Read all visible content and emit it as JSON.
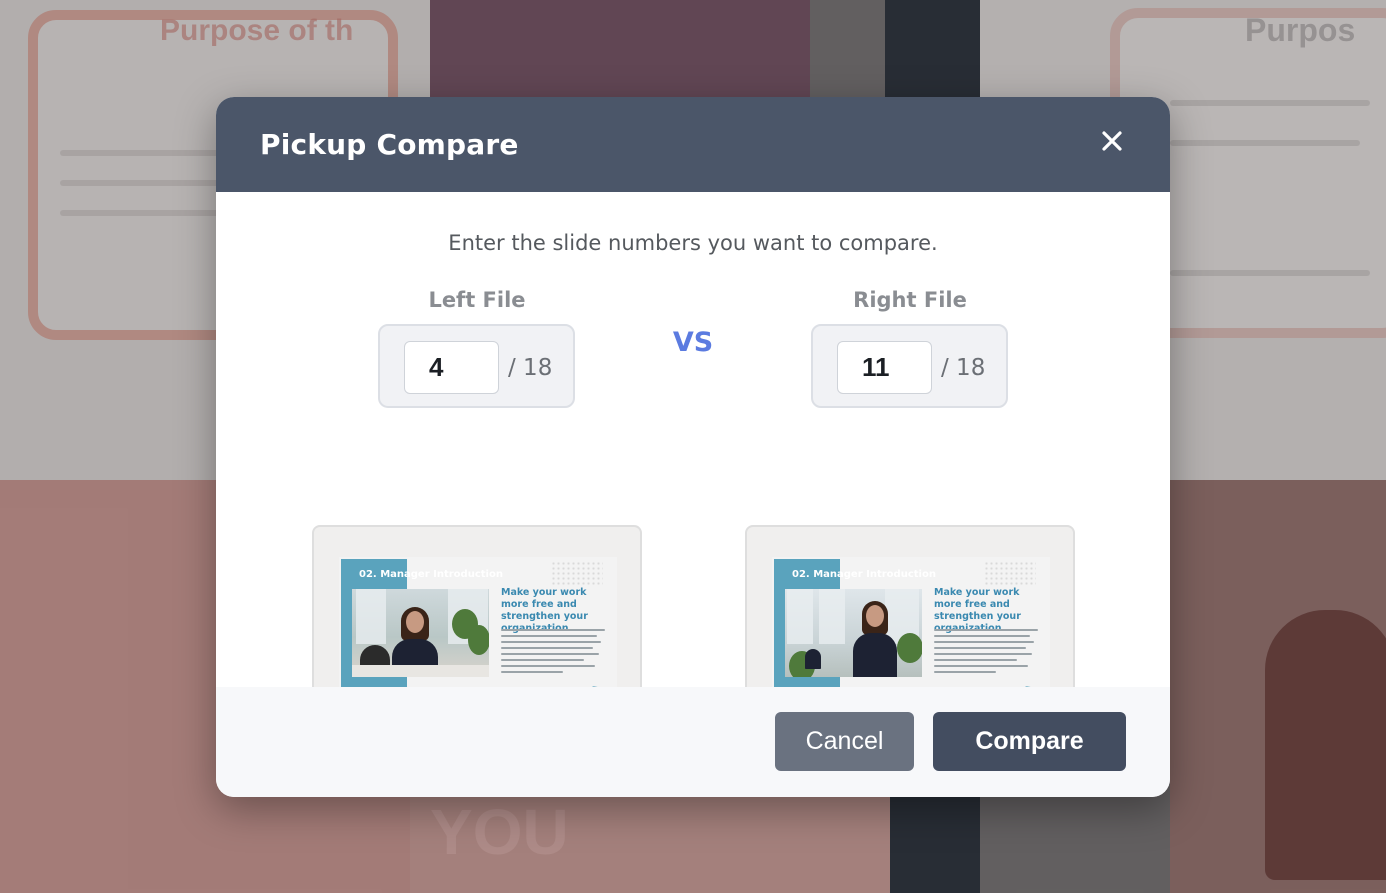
{
  "background": {
    "left_title": "Purpose of th",
    "right_title": "Purpos",
    "bottom_word": "YOU"
  },
  "dialog": {
    "title": "Pickup Compare",
    "close_icon": "close-icon",
    "instruction": "Enter the slide numbers you want to compare.",
    "vs_label": "VS",
    "left": {
      "label": "Left File",
      "value": "4",
      "total": "/ 18",
      "slide": {
        "header": "02. Manager Introduction",
        "title": "Make your work more free and strengthen your organization."
      }
    },
    "right": {
      "label": "Right File",
      "value": "11",
      "total": "/ 18",
      "slide": {
        "header": "02. Manager Introduction",
        "title": "Make your work more free and strengthen your organization."
      }
    },
    "buttons": {
      "cancel": "Cancel",
      "compare": "Compare"
    }
  },
  "colors": {
    "header_bg": "#4b5669",
    "accent_vs": "#5b7be0",
    "slide_accent": "#5aa3bd",
    "cancel_bg": "#6a7280",
    "compare_bg": "#434d60"
  }
}
